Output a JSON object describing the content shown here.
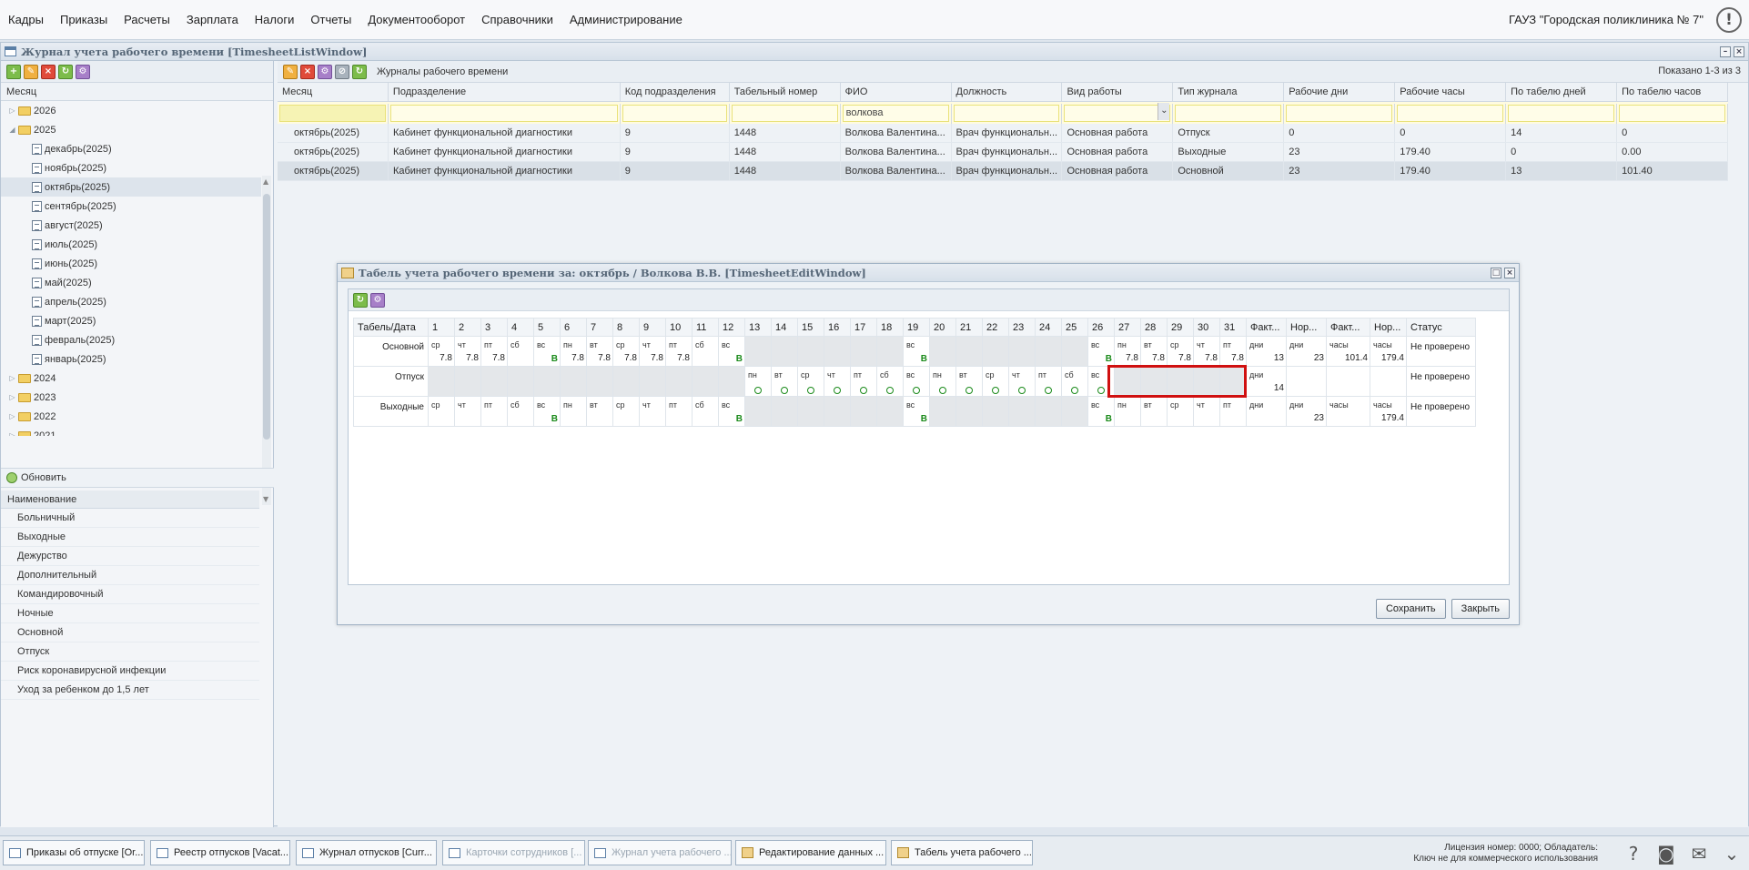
{
  "menu": [
    "Кадры",
    "Приказы",
    "Расчеты",
    "Зарплата",
    "Налоги",
    "Отчеты",
    "Документооборот",
    "Справочники",
    "Администрирование"
  ],
  "org": "ГАУЗ \"Городская поликлиника № 7\"",
  "listWindow": {
    "title": "Журнал учета рабочего времени [TimesheetListWindow]"
  },
  "left": {
    "month_header": "Месяц",
    "tree": [
      {
        "label": "2026",
        "type": "folder",
        "level": 0,
        "expand": "▷"
      },
      {
        "label": "2025",
        "type": "folder",
        "level": 0,
        "expand": "◢"
      },
      {
        "label": "декабрь(2025)",
        "type": "doc",
        "level": 1
      },
      {
        "label": "ноябрь(2025)",
        "type": "doc",
        "level": 1
      },
      {
        "label": "октябрь(2025)",
        "type": "doc",
        "level": 1,
        "selected": true
      },
      {
        "label": "сентябрь(2025)",
        "type": "doc",
        "level": 1
      },
      {
        "label": "август(2025)",
        "type": "doc",
        "level": 1
      },
      {
        "label": "июль(2025)",
        "type": "doc",
        "level": 1
      },
      {
        "label": "июнь(2025)",
        "type": "doc",
        "level": 1
      },
      {
        "label": "май(2025)",
        "type": "doc",
        "level": 1
      },
      {
        "label": "апрель(2025)",
        "type": "doc",
        "level": 1
      },
      {
        "label": "март(2025)",
        "type": "doc",
        "level": 1
      },
      {
        "label": "февраль(2025)",
        "type": "doc",
        "level": 1
      },
      {
        "label": "январь(2025)",
        "type": "doc",
        "level": 1
      },
      {
        "label": "2024",
        "type": "folder",
        "level": 0,
        "expand": "▷"
      },
      {
        "label": "2023",
        "type": "folder",
        "level": 0,
        "expand": "▷"
      },
      {
        "label": "2022",
        "type": "folder",
        "level": 0,
        "expand": "▷"
      },
      {
        "label": "2021",
        "type": "folder",
        "level": 0,
        "expand": "▷"
      }
    ],
    "refresh_label": "Обновить",
    "name_header": "Наименование",
    "names": [
      "Больничный",
      "Выходные",
      "Дежурство",
      "Дополнительный",
      "Командировочный",
      "Ночные",
      "Основной",
      "Отпуск",
      "Риск коронавирусной инфекции",
      "Уход за ребенком до 1,5 лет"
    ]
  },
  "main": {
    "toolbar_label": "Журналы рабочего времени",
    "shown": "Показано 1-3 из 3",
    "columns": [
      "Месяц",
      "Подразделение",
      "Код подразделения",
      "Табельный номер",
      "ФИО",
      "Должность",
      "Вид работы",
      "Тип журнала",
      "Рабочие дни",
      "Рабочие часы",
      "По табелю дней",
      "По табелю часов"
    ],
    "filters": [
      "",
      "",
      "",
      "",
      "волкова",
      "",
      "",
      "",
      "",
      "",
      "",
      ""
    ],
    "rows": [
      [
        "октябрь(2025)",
        "Кабинет функциональной диагностики",
        "9",
        "1448",
        "Волкова Валентина...",
        "Врач функциональн...",
        "Основная работа",
        "Отпуск",
        "0",
        "0",
        "14",
        "0"
      ],
      [
        "октябрь(2025)",
        "Кабинет функциональной диагностики",
        "9",
        "1448",
        "Волкова Валентина...",
        "Врач функциональн...",
        "Основная работа",
        "Выходные",
        "23",
        "179.40",
        "0",
        "0.00"
      ],
      [
        "октябрь(2025)",
        "Кабинет функциональной диагностики",
        "9",
        "1448",
        "Волкова Валентина...",
        "Врач функциональн...",
        "Основная работа",
        "Основной",
        "23",
        "179.40",
        "13",
        "101.40"
      ]
    ]
  },
  "editWindow": {
    "title": "Табель учета рабочего времени за: октябрь / Волкова В.В. [TimesheetEditWindow]",
    "header_first": "Табель/Дата",
    "days": [
      "1",
      "2",
      "3",
      "4",
      "5",
      "6",
      "7",
      "8",
      "9",
      "10",
      "11",
      "12",
      "13",
      "14",
      "15",
      "16",
      "17",
      "18",
      "19",
      "20",
      "21",
      "22",
      "23",
      "24",
      "25",
      "26",
      "27",
      "28",
      "29",
      "30",
      "31"
    ],
    "summary_headers": [
      "Факт...",
      "Нор...",
      "Факт...",
      "Нор...",
      "Статус"
    ],
    "rows": [
      {
        "label": "Основной",
        "cells": [
          [
            "ср",
            "7.8"
          ],
          [
            "чт",
            "7.8"
          ],
          [
            "пт",
            "7.8"
          ],
          [
            "сб",
            ""
          ],
          [
            "вс",
            "В"
          ],
          [
            "пн",
            "7.8"
          ],
          [
            "вт",
            "7.8"
          ],
          [
            "ср",
            "7.8"
          ],
          [
            "чт",
            "7.8"
          ],
          [
            "пт",
            "7.8"
          ],
          [
            "сб",
            ""
          ],
          [
            "вс",
            "В"
          ],
          [
            "",
            ""
          ],
          [
            "",
            ""
          ],
          [
            "",
            ""
          ],
          [
            "",
            ""
          ],
          [
            "",
            ""
          ],
          [
            "",
            ""
          ],
          [
            "вс",
            "В"
          ],
          [
            "",
            ""
          ],
          [
            "",
            ""
          ],
          [
            "",
            ""
          ],
          [
            "",
            ""
          ],
          [
            "",
            ""
          ],
          [
            "",
            ""
          ],
          [
            "вс",
            "В"
          ],
          [
            "пн",
            "7.8"
          ],
          [
            "вт",
            "7.8"
          ],
          [
            "ср",
            "7.8"
          ],
          [
            "чт",
            "7.8"
          ],
          [
            "пт",
            "7.8"
          ]
        ],
        "summary": [
          [
            "дни",
            "13"
          ],
          [
            "дни",
            "23"
          ],
          [
            "часы",
            "101.4"
          ],
          [
            "часы",
            "179.4"
          ]
        ],
        "status": "Не проверено"
      },
      {
        "label": "Отпуск",
        "cells": [
          [
            "",
            ""
          ],
          [
            "",
            ""
          ],
          [
            "",
            ""
          ],
          [
            "",
            ""
          ],
          [
            "",
            ""
          ],
          [
            "",
            ""
          ],
          [
            "",
            ""
          ],
          [
            "",
            ""
          ],
          [
            "",
            ""
          ],
          [
            "",
            ""
          ],
          [
            "",
            ""
          ],
          [
            "",
            ""
          ],
          [
            "пн",
            "O"
          ],
          [
            "вт",
            "O"
          ],
          [
            "ср",
            "O"
          ],
          [
            "чт",
            "O"
          ],
          [
            "пт",
            "O"
          ],
          [
            "сб",
            "O"
          ],
          [
            "вс",
            "O"
          ],
          [
            "пн",
            "O"
          ],
          [
            "вт",
            "O"
          ],
          [
            "ср",
            "O"
          ],
          [
            "чт",
            "O"
          ],
          [
            "пт",
            "O"
          ],
          [
            "сб",
            "O"
          ],
          [
            "вс",
            "O"
          ],
          [
            "",
            ""
          ],
          [
            "",
            ""
          ],
          [
            "",
            ""
          ],
          [
            "",
            ""
          ],
          [
            "",
            ""
          ]
        ],
        "summary": [
          [
            "дни",
            "14"
          ],
          [
            "",
            ""
          ],
          [
            "",
            ""
          ],
          [
            "",
            ""
          ]
        ],
        "status": "Не проверено"
      },
      {
        "label": "Выходные",
        "cells": [
          [
            "ср",
            ""
          ],
          [
            "чт",
            ""
          ],
          [
            "пт",
            ""
          ],
          [
            "сб",
            ""
          ],
          [
            "вс",
            "В"
          ],
          [
            "пн",
            ""
          ],
          [
            "вт",
            ""
          ],
          [
            "ср",
            ""
          ],
          [
            "чт",
            ""
          ],
          [
            "пт",
            ""
          ],
          [
            "сб",
            ""
          ],
          [
            "вс",
            "В"
          ],
          [
            "",
            ""
          ],
          [
            "",
            ""
          ],
          [
            "",
            ""
          ],
          [
            "",
            ""
          ],
          [
            "",
            ""
          ],
          [
            "",
            ""
          ],
          [
            "вс",
            "В"
          ],
          [
            "",
            ""
          ],
          [
            "",
            ""
          ],
          [
            "",
            ""
          ],
          [
            "",
            ""
          ],
          [
            "",
            ""
          ],
          [
            "",
            ""
          ],
          [
            "вс",
            "В"
          ],
          [
            "пн",
            ""
          ],
          [
            "вт",
            ""
          ],
          [
            "ср",
            ""
          ],
          [
            "чт",
            ""
          ],
          [
            "пт",
            ""
          ]
        ],
        "summary": [
          [
            "дни",
            ""
          ],
          [
            "дни",
            "23"
          ],
          [
            "часы",
            ""
          ],
          [
            "часы",
            "179.4"
          ]
        ],
        "status": "Не проверено"
      }
    ],
    "save_label": "Сохранить",
    "close_label": "Закрыть"
  },
  "taskbar": {
    "tasks": [
      {
        "label": "Приказы об отпуске [Or...",
        "dim": false,
        "pen": false
      },
      {
        "label": "Реестр отпусков [Vacat...",
        "dim": false,
        "pen": false
      },
      {
        "label": "Журнал отпусков [Curr...",
        "dim": false,
        "pen": false
      },
      {
        "label": "Карточки сотрудников [...",
        "dim": true,
        "pen": false
      },
      {
        "label": "Журнал учета рабочего ...",
        "dim": true,
        "pen": false
      },
      {
        "label": "Редактирование данных ...",
        "dim": false,
        "pen": true
      },
      {
        "label": "Табель учета рабочего ...",
        "dim": false,
        "pen": true
      }
    ],
    "license_line1": "Лицензия номер: 0000; Обладатель:",
    "license_line2": "Ключ не для коммерческого использования"
  }
}
